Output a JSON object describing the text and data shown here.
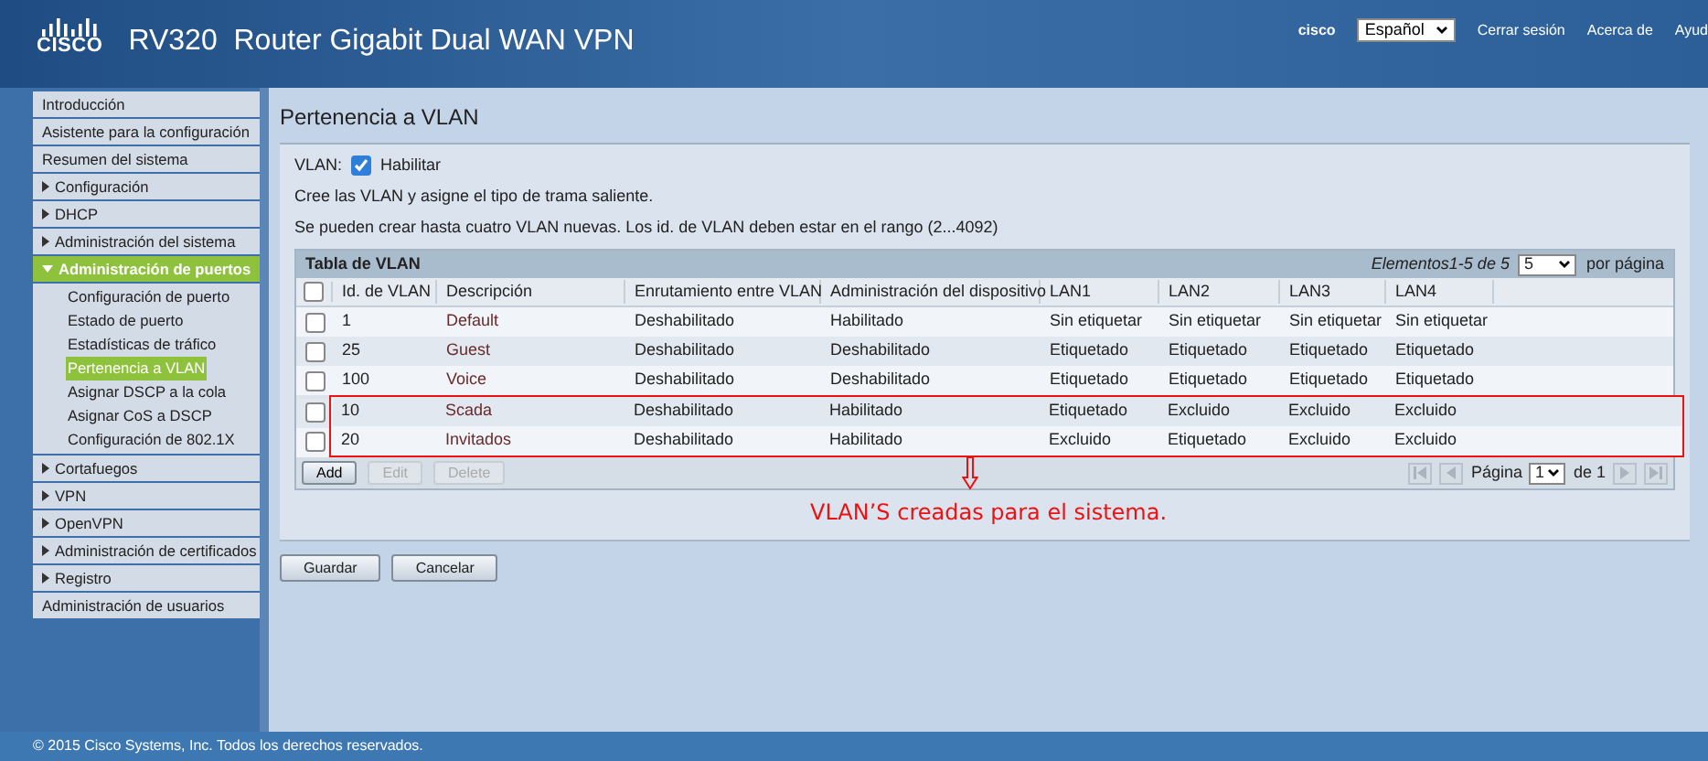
{
  "header": {
    "logo_text": "CISCO",
    "product": "RV320  Router Gigabit Dual WAN VPN",
    "user": "cisco",
    "language": "Español",
    "links": [
      "Cerrar sesión",
      "Acerca de",
      "Ayud"
    ]
  },
  "sidebar": {
    "items": [
      {
        "label": "Introducción",
        "kind": "link"
      },
      {
        "label": "Asistente para la configuración",
        "kind": "link"
      },
      {
        "label": "Resumen del sistema",
        "kind": "link"
      },
      {
        "label": "Configuración",
        "kind": "group",
        "expanded": false
      },
      {
        "label": "DHCP",
        "kind": "group",
        "expanded": false
      },
      {
        "label": "Administración del sistema",
        "kind": "group",
        "expanded": false
      },
      {
        "label": "Administración de puertos",
        "kind": "group",
        "expanded": true,
        "children": [
          {
            "label": "Configuración de puerto",
            "selected": false
          },
          {
            "label": "Estado de puerto",
            "selected": false
          },
          {
            "label": "Estadísticas de tráfico",
            "selected": false
          },
          {
            "label": "Pertenencia a VLAN",
            "selected": true
          },
          {
            "label": "Asignar DSCP a la cola",
            "selected": false
          },
          {
            "label": "Asignar CoS a DSCP",
            "selected": false
          },
          {
            "label": "Configuración de 802.1X",
            "selected": false
          }
        ]
      },
      {
        "label": "Cortafuegos",
        "kind": "group",
        "expanded": false
      },
      {
        "label": "VPN",
        "kind": "group",
        "expanded": false
      },
      {
        "label": "OpenVPN",
        "kind": "group",
        "expanded": false
      },
      {
        "label": "Administración de certificados",
        "kind": "group",
        "expanded": false
      },
      {
        "label": "Registro",
        "kind": "group",
        "expanded": false
      },
      {
        "label": "Administración de usuarios",
        "kind": "link"
      }
    ]
  },
  "page": {
    "title": "Pertenencia a VLAN",
    "vlan_label": "VLAN:",
    "vlan_enabled": true,
    "enable_label": "Habilitar",
    "notes": [
      "Cree las VLAN y asigne el tipo de trama saliente.",
      "Se pueden crear hasta cuatro VLAN nuevas. Los id. de VLAN deben estar en el rango (2...4092)"
    ]
  },
  "table": {
    "title": "Tabla de VLAN",
    "items_text": "Elementos1-5 de 5",
    "select_all_checked": false,
    "per_page": "5",
    "per_page_label": "por página",
    "columns": [
      "Id. de VLAN",
      "Descripción",
      "Enrutamiento entre VLAN",
      "Administración del dispositivo",
      "LAN1",
      "LAN2",
      "LAN3",
      "LAN4"
    ],
    "rows": [
      {
        "checked": false,
        "highlighted": false,
        "cells": [
          "1",
          "Default",
          "Deshabilitado",
          "Habilitado",
          "Sin etiquetar",
          "Sin etiquetar",
          "Sin etiquetar",
          "Sin etiquetar"
        ]
      },
      {
        "checked": false,
        "highlighted": false,
        "cells": [
          "25",
          "Guest",
          "Deshabilitado",
          "Deshabilitado",
          "Etiquetado",
          "Etiquetado",
          "Etiquetado",
          "Etiquetado"
        ]
      },
      {
        "checked": false,
        "highlighted": false,
        "cells": [
          "100",
          "Voice",
          "Deshabilitado",
          "Deshabilitado",
          "Etiquetado",
          "Etiquetado",
          "Etiquetado",
          "Etiquetado"
        ]
      },
      {
        "checked": false,
        "highlighted": true,
        "cells": [
          "10",
          "Scada",
          "Deshabilitado",
          "Habilitado",
          "Etiquetado",
          "Excluido",
          "Excluido",
          "Excluido"
        ]
      },
      {
        "checked": false,
        "highlighted": true,
        "cells": [
          "20",
          "Invitados",
          "Deshabilitado",
          "Habilitado",
          "Excluido",
          "Etiquetado",
          "Excluido",
          "Excluido"
        ]
      }
    ],
    "buttons": [
      {
        "label": "Add",
        "disabled": false
      },
      {
        "label": "Edit",
        "disabled": true
      },
      {
        "label": "Delete",
        "disabled": true
      }
    ],
    "page_label": "Página",
    "page": "1",
    "page_of": "de 1"
  },
  "annotation": "VLAN’S creadas para el sistema.",
  "actions": [
    "Guardar",
    "Cancelar"
  ],
  "footer": "© 2015 Cisco Systems, Inc. Todos los derechos reservados."
}
